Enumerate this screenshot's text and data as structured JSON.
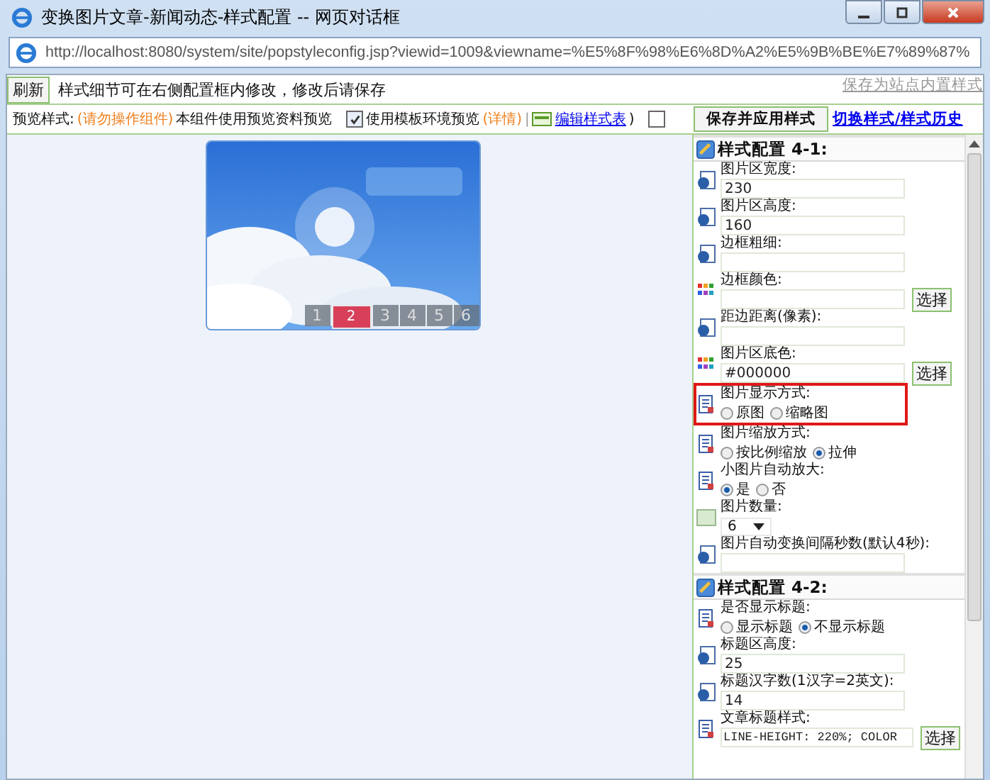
{
  "window": {
    "title": "变换图片文章-新闻动态-样式配置 -- 网页对话框"
  },
  "address": {
    "url": "http://localhost:8080/system/site/popstyleconfig.jsp?viewid=1009&viewname=%E5%8F%98%E6%8D%A2%E5%9B%BE%E7%89%87%"
  },
  "toolbar": {
    "refresh_button": "刷新",
    "hint": "样式细节可在右侧配置框内修改，修改后请保存",
    "save_builtin_link": "保存为站点内置样式"
  },
  "preview_bar": {
    "label": "预览样式:",
    "warning": "(请勿操作组件)",
    "note": "本组件使用预览资料预览",
    "env_checkbox": {
      "label": "使用模板环境预览",
      "checked": true
    },
    "details": "(详情)",
    "separator": "|",
    "edit_link": "编辑样式表",
    "close_paren": ")",
    "extra_checkbox": {
      "checked": false
    },
    "save_apply_button": "保存并应用样式",
    "switch_link": "切换样式/样式历史"
  },
  "preview": {
    "pager": [
      {
        "label": "1",
        "selected": false
      },
      {
        "label": "2",
        "selected": true
      },
      {
        "label": "3",
        "selected": false
      },
      {
        "label": "4",
        "selected": false
      },
      {
        "label": "5",
        "selected": false
      },
      {
        "label": "6",
        "selected": false
      }
    ]
  },
  "config": {
    "sections": [
      {
        "title": "样式配置 4-1:",
        "items": [
          {
            "kind": "text",
            "label": "图片区宽度:",
            "value": "230"
          },
          {
            "kind": "text",
            "label": "图片区高度:",
            "value": "160"
          },
          {
            "kind": "text",
            "label": "边框粗细:"
          },
          {
            "kind": "color",
            "label": "边框颜色:",
            "button": "选择"
          },
          {
            "kind": "text",
            "label": "距边距离(像素):"
          },
          {
            "kind": "color",
            "label": "图片区底色:",
            "value": "#000000",
            "button": "选择"
          },
          {
            "kind": "radio",
            "label": "图片显示方式:",
            "highlighted": true,
            "options": [
              {
                "label": "原图",
                "selected": false
              },
              {
                "label": "缩略图",
                "selected": false
              }
            ]
          },
          {
            "kind": "radio",
            "label": "图片缩放方式:",
            "options": [
              {
                "label": "按比例缩放",
                "selected": false
              },
              {
                "label": "拉伸",
                "selected": true
              }
            ]
          },
          {
            "kind": "radio",
            "label": "小图片自动放大:",
            "options": [
              {
                "label": "是",
                "selected": true
              },
              {
                "label": "否",
                "selected": false
              }
            ]
          },
          {
            "kind": "select",
            "label": "图片数量:",
            "value": "6"
          },
          {
            "kind": "text",
            "label": "图片自动变换间隔秒数(默认4秒):"
          }
        ]
      },
      {
        "title": "样式配置 4-2:",
        "items": [
          {
            "kind": "radio",
            "label": "是否显示标题:",
            "options": [
              {
                "label": "显示标题",
                "selected": false
              },
              {
                "label": "不显示标题",
                "selected": true
              }
            ]
          },
          {
            "kind": "text",
            "label": "标题区高度:",
            "value": "25"
          },
          {
            "kind": "text",
            "label": "标题汉字数(1汉字=2英文):",
            "value": "14"
          },
          {
            "kind": "style",
            "label": "文章标题样式:",
            "value": "LINE-HEIGHT: 220%; COLOR",
            "button": "选择"
          }
        ]
      }
    ]
  }
}
